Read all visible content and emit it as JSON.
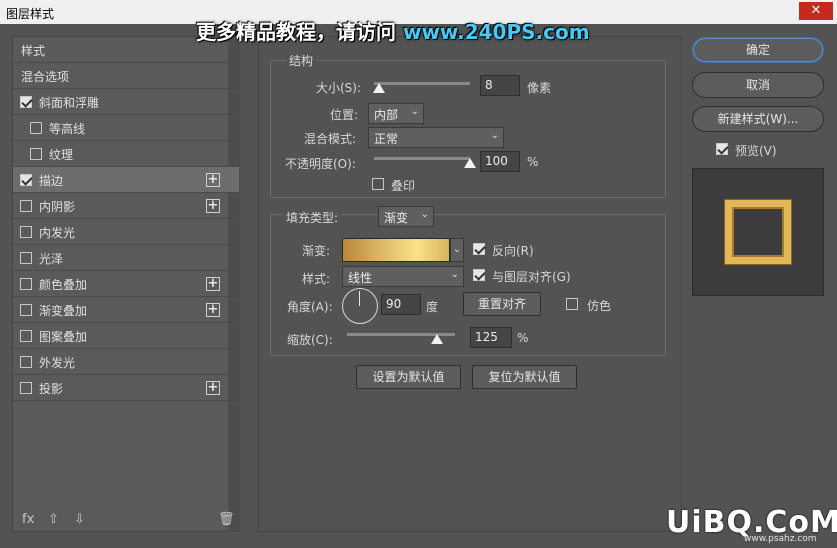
{
  "window": {
    "title": "图层样式",
    "close_glyph": "✕"
  },
  "watermark": {
    "text_main": "更多精品教程，请访问 ",
    "text_url": "www.240PS.com"
  },
  "left_list": {
    "header": "样式",
    "items": [
      {
        "label": "混合选项",
        "checkbox": null,
        "plus": false,
        "indent": false
      },
      {
        "label": "斜面和浮雕",
        "checkbox": true,
        "plus": false,
        "indent": false
      },
      {
        "label": "等高线",
        "checkbox": false,
        "plus": false,
        "indent": true
      },
      {
        "label": "纹理",
        "checkbox": false,
        "plus": false,
        "indent": true
      },
      {
        "label": "描边",
        "checkbox": true,
        "plus": true,
        "indent": false,
        "selected": true
      },
      {
        "label": "内阴影",
        "checkbox": false,
        "plus": true,
        "indent": false
      },
      {
        "label": "内发光",
        "checkbox": false,
        "plus": false,
        "indent": false
      },
      {
        "label": "光泽",
        "checkbox": false,
        "plus": false,
        "indent": false
      },
      {
        "label": "颜色叠加",
        "checkbox": false,
        "plus": true,
        "indent": false
      },
      {
        "label": "渐变叠加",
        "checkbox": false,
        "plus": true,
        "indent": false
      },
      {
        "label": "图案叠加",
        "checkbox": false,
        "plus": false,
        "indent": false
      },
      {
        "label": "外发光",
        "checkbox": false,
        "plus": false,
        "indent": false
      },
      {
        "label": "投影",
        "checkbox": false,
        "plus": true,
        "indent": false
      }
    ],
    "bottom_icons": {
      "fx": "fx",
      "up": "⇧",
      "down": "⇩",
      "trash": "🗑"
    }
  },
  "structure": {
    "legend": "结构",
    "size_label": "大小(S):",
    "size_value": "8",
    "size_unit": "像素",
    "size_level": 0.05,
    "position_label": "位置:",
    "position_value": "内部",
    "blend_label": "混合模式:",
    "blend_value": "正常",
    "opacity_label": "不透明度(O):",
    "opacity_value": "100",
    "opacity_unit": "%",
    "opacity_level": 1.0,
    "overprint_label": "叠印",
    "overprint_checked": false
  },
  "fill": {
    "type_label": "填充类型:",
    "type_value": "渐变",
    "gradient_label": "渐变:",
    "reverse_label": "反向(R)",
    "reverse_checked": true,
    "style_label": "样式:",
    "style_value": "线性",
    "align_label": "与图层对齐(G)",
    "align_checked": true,
    "angle_label": "角度(A):",
    "angle_value": "90",
    "angle_unit": "度",
    "reset_align_button": "重置对齐",
    "dither_label": "仿色",
    "dither_checked": false,
    "scale_label": "缩放(C):",
    "scale_value": "125",
    "scale_unit": "%",
    "scale_level": 0.83
  },
  "defaults": {
    "make_default": "设置为默认值",
    "reset_default": "复位为默认值"
  },
  "right": {
    "ok": "确定",
    "cancel": "取消",
    "new_style": "新建样式(W)...",
    "preview_label": "预览(V)",
    "preview_checked": true
  },
  "corner_watermark": {
    "logo": "UiBQ.CoM",
    "url": "www.psahz.com"
  },
  "colors": {
    "accent_blue": "#49c7f5",
    "gold": "#e2b75a",
    "panel": "#535353"
  }
}
